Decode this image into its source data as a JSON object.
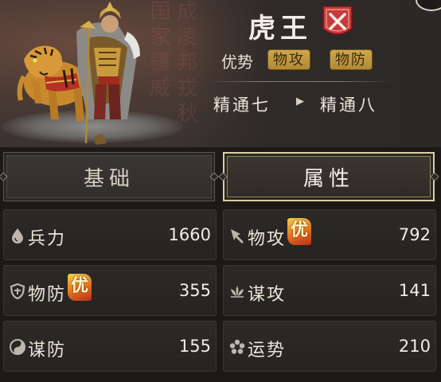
{
  "hero": {
    "name": "虎王",
    "advantage_label": "优势",
    "advantage_tags": [
      "物攻",
      "物防"
    ],
    "mastery_from": "精通七",
    "mastery_to": "精通八",
    "background_text": "成凌邦戎秋国家疆威"
  },
  "tabs": [
    {
      "label": "基础",
      "selected": false
    },
    {
      "label": "属性",
      "selected": true
    }
  ],
  "stats": [
    {
      "label": "兵力",
      "value": "1660",
      "icon": "drop-icon",
      "advantage": false
    },
    {
      "label": "物攻",
      "value": "792",
      "icon": "sword-icon",
      "advantage": true
    },
    {
      "label": "物防",
      "value": "355",
      "icon": "shield-icon",
      "advantage": true
    },
    {
      "label": "谋攻",
      "value": "141",
      "icon": "lotus-icon",
      "advantage": false
    },
    {
      "label": "谋防",
      "value": "155",
      "icon": "yin-yang-icon",
      "advantage": false
    },
    {
      "label": "运势",
      "value": "210",
      "icon": "flower-icon",
      "advantage": false
    }
  ],
  "advantage_badge": "优",
  "colors": {
    "tag_gold": "#c29a40",
    "badge_red": "#c83a3a",
    "selected_border": "#d8cfa4"
  }
}
